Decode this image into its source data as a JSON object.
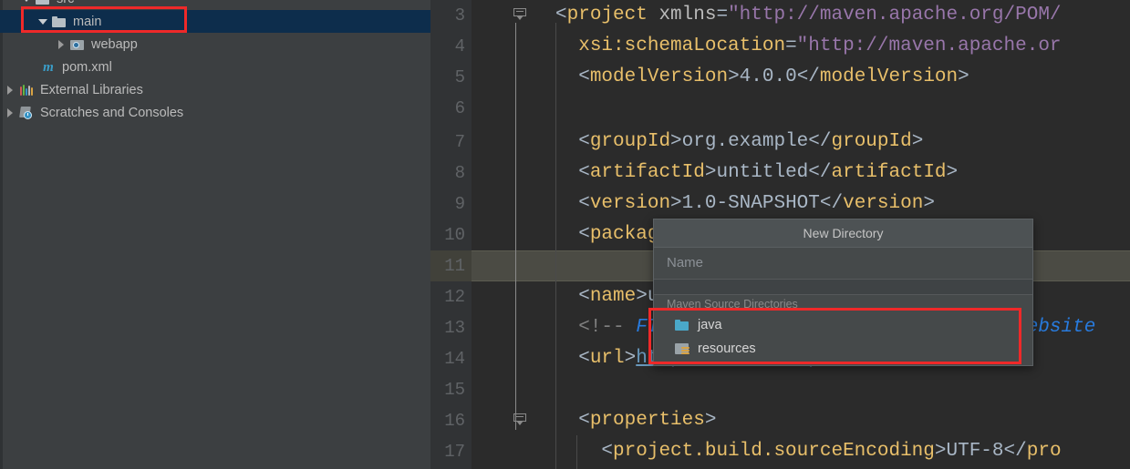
{
  "project_tree": {
    "items": [
      {
        "label": "src",
        "icon": "folder-icon",
        "arrow": "down",
        "indent": 22,
        "selected": false,
        "cut_off": true
      },
      {
        "label": "main",
        "icon": "folder-icon",
        "arrow": "down",
        "indent": 40,
        "selected": true
      },
      {
        "label": "webapp",
        "icon": "webapp-folder-icon",
        "arrow": "right",
        "indent": 60,
        "selected": false
      },
      {
        "label": "pom.xml",
        "icon": "maven-file-icon",
        "arrow": "none",
        "indent": 44,
        "selected": false
      },
      {
        "label": "External Libraries",
        "icon": "external-libraries-icon",
        "arrow": "right",
        "indent": 4,
        "selected": false
      },
      {
        "label": "Scratches and Consoles",
        "icon": "scratches-icon",
        "arrow": "right",
        "indent": 4,
        "selected": false
      }
    ]
  },
  "editor": {
    "language": "xml",
    "current_line": 11,
    "lines": [
      {
        "number": "3",
        "text": "<project xmlns=\"http://maven.apache.org/POM/"
      },
      {
        "number": "4",
        "text": "  xsi:schemaLocation=\"http://maven.apache.or"
      },
      {
        "number": "5",
        "text": "  <modelVersion>4.0.0</modelVersion>"
      },
      {
        "number": "6",
        "text": ""
      },
      {
        "number": "7",
        "text": "  <groupId>org.example</groupId>"
      },
      {
        "number": "8",
        "text": "  <artifactId>untitled</artifactId>"
      },
      {
        "number": "9",
        "text": "  <version>1.0-SNAPSHOT</version>"
      },
      {
        "number": "10",
        "text": "  <packaging>war</packaging>"
      },
      {
        "number": "11",
        "text": ""
      },
      {
        "number": "12",
        "text": "  <name>untitled</name>"
      },
      {
        "number": "13",
        "text": "  <!-- FIXME change it to the project's website"
      },
      {
        "number": "14",
        "text": "  <url>http://www.example.com</url>"
      },
      {
        "number": "15",
        "text": ""
      },
      {
        "number": "16",
        "text": "  <properties>"
      },
      {
        "number": "17",
        "text": "    <project.build.sourceEncoding>UTF-8</pro"
      }
    ]
  },
  "popup": {
    "title": "New Directory",
    "name_placeholder": "Name",
    "name_value": "",
    "section_label": "Maven Source Directories",
    "items": [
      {
        "label": "java",
        "icon": "blue-folder-icon"
      },
      {
        "label": "resources",
        "icon": "resources-folder-icon"
      }
    ]
  },
  "colors": {
    "sidebar_bg": "#3c3f41",
    "editor_bg": "#2b2b2b",
    "gutter_bg": "#313335",
    "selection_bg": "#0d2d4c",
    "popup_bg": "#45494a",
    "popup_header_bg": "#4d5254",
    "annotation_red": "#ef2929",
    "tag_color": "#e8bf6a",
    "string_color": "#a5c261",
    "comment_color": "#808080"
  },
  "annotations": [
    {
      "name": "highlight-main-node"
    },
    {
      "name": "highlight-maven-source-directories"
    }
  ]
}
